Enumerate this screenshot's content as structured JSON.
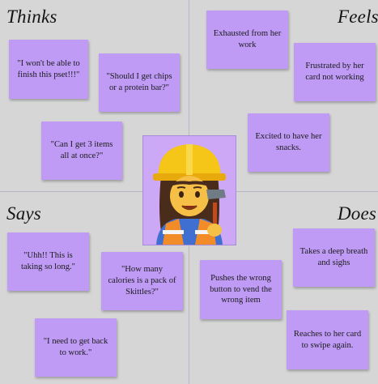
{
  "quadrants": {
    "thinks": "Thinks",
    "feels": "Feels",
    "says": "Says",
    "does": "Does"
  },
  "center": {
    "icon": "woman-construction-worker-icon"
  },
  "notes": {
    "thinks": [
      "\"I won't be able to finish this pset!!!\"",
      "\"Should I get chips or a protein bar?\"",
      "\"Can I get 3 items all at once?\""
    ],
    "feels": [
      "Exhausted from her work",
      "Frustrated by her card not working",
      "Excited to have her snacks."
    ],
    "says": [
      "\"Uhh!! This is taking so long.\"",
      "\"How many calories is a pack of Skittles?\"",
      "\"I need to get back to work.\""
    ],
    "does": [
      "Takes a deep breath and sighs",
      "Pushes the wrong button to vend the wrong item",
      "Reaches to her card to swipe again."
    ]
  },
  "colors": {
    "note": "#bf9bf6",
    "background": "#d6d6d6",
    "helmet": "#f5c518",
    "vest": "#f28c28"
  }
}
